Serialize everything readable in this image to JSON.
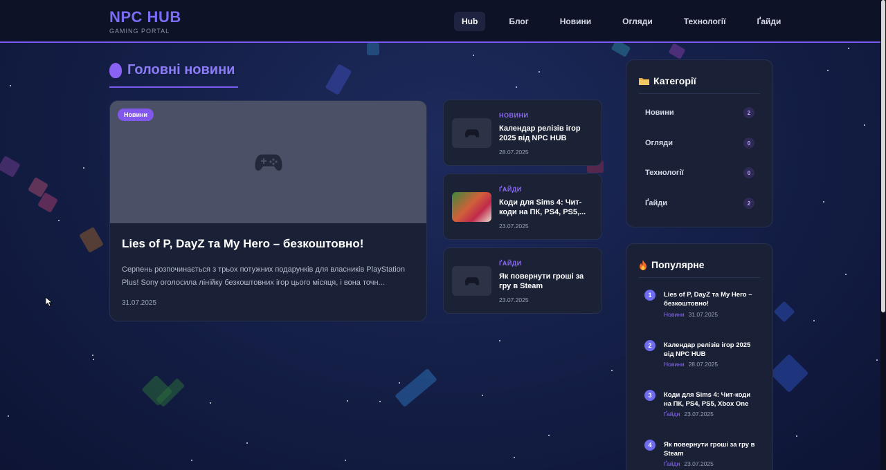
{
  "header": {
    "logo_title": "NPC HUB",
    "logo_subtitle": "GAMING PORTAL",
    "nav": [
      "Hub",
      "Блог",
      "Новини",
      "Огляди",
      "Технології",
      "Ґайди"
    ],
    "active_nav": "Hub"
  },
  "main": {
    "section_title": "Головні новини",
    "featured": {
      "badge": "Новини",
      "title": "Lies of P, DayZ та My Hero – безкоштовно!",
      "excerpt": "Серпень розпочинається з трьох потужних подарунків для власників PlayStation Plus! Sony оголосила лінійку безкоштовних ігор цього місяця, і вона точн...",
      "date": "31.07.2025"
    },
    "cards": [
      {
        "category": "НОВИНИ",
        "title": "Календар релізів ігор 2025 від NPC HUB",
        "date": "28.07.2025",
        "thumb": "gamepad-icon"
      },
      {
        "category": "ҐАЙДИ",
        "title": "Коди для Sims 4: Чит-коди на ПК, PS4, PS5,...",
        "date": "23.07.2025",
        "thumb": "image"
      },
      {
        "category": "ҐАЙДИ",
        "title": "Як повернути гроші за гру в Steam",
        "date": "23.07.2025",
        "thumb": "gamepad-icon"
      }
    ]
  },
  "sidebar": {
    "categories": {
      "title": "Категорії",
      "icon": "folder-icon",
      "items": [
        {
          "name": "Новини",
          "count": "2"
        },
        {
          "name": "Огляди",
          "count": "0"
        },
        {
          "name": "Технології",
          "count": "0"
        },
        {
          "name": "Ґайди",
          "count": "2"
        }
      ]
    },
    "popular": {
      "title": "Популярне",
      "icon": "fire-icon",
      "items": [
        {
          "num": "1",
          "title": "Lies of P, DayZ та My Hero – безкоштовно!",
          "category": "Новини",
          "date": "31.07.2025"
        },
        {
          "num": "2",
          "title": "Календар релізів ігор 2025 від NPC HUB",
          "category": "Новини",
          "date": "28.07.2025"
        },
        {
          "num": "3",
          "title": "Коди для Sims 4: Чит-коди на ПК, PS4, PS5, Xbox One",
          "category": "Ґайди",
          "date": "23.07.2025"
        },
        {
          "num": "4",
          "title": "Як повернути гроші за гру в Steam",
          "category": "Ґайди",
          "date": "23.07.2025"
        }
      ]
    }
  },
  "colors": {
    "accent": "#7c5cf0",
    "background": "#152049",
    "card": "#1a2136"
  }
}
